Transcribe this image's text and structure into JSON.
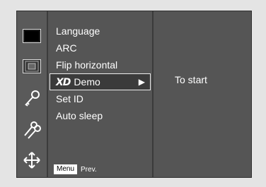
{
  "menu": {
    "items": [
      {
        "label": "Language"
      },
      {
        "label": "ARC"
      },
      {
        "label": "Flip horizontal"
      },
      {
        "label": "Demo",
        "prefix": "XD",
        "selected": true
      },
      {
        "label": "Set ID"
      },
      {
        "label": "Auto sleep"
      }
    ]
  },
  "submenu": {
    "text": "To start"
  },
  "footer": {
    "menu_key": "Menu",
    "prev_label": "Prev."
  },
  "icons": [
    "picture-icon",
    "screen-icon",
    "key-icon",
    "keys-icon",
    "arrows-icon"
  ]
}
